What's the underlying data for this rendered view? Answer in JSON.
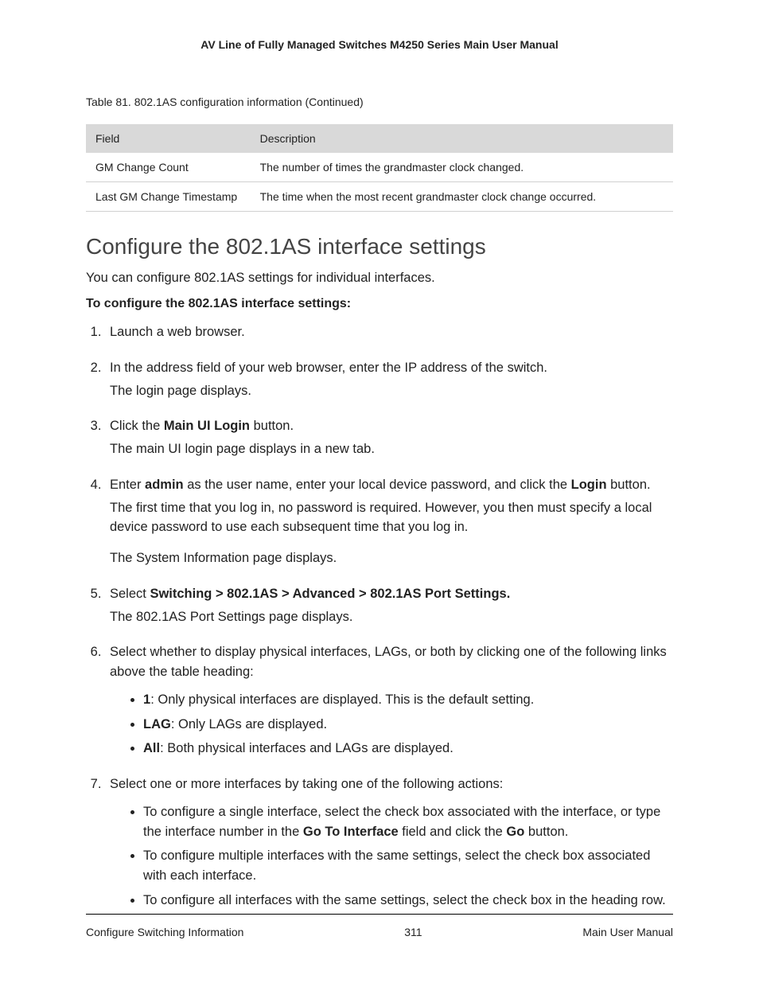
{
  "header_title": "AV Line of Fully Managed Switches M4250 Series Main User Manual",
  "table_caption": "Table 81. 802.1AS configuration information (Continued)",
  "table": {
    "headers": [
      "Field",
      "Description"
    ],
    "rows": [
      {
        "field": "GM Change Count",
        "desc": "The number of times the grandmaster clock changed."
      },
      {
        "field": "Last GM Change Timestamp",
        "desc": "The time when the most recent grandmaster clock change occurred."
      }
    ]
  },
  "section_heading": "Configure the 802.1AS interface settings",
  "intro": "You can configure 802.1AS settings for individual interfaces.",
  "subheading": "To configure the 802.1AS interface settings:",
  "steps": {
    "s1": "Launch a web browser.",
    "s2_a": "In the address field of your web browser, enter the IP address of the switch.",
    "s2_b": "The login page displays.",
    "s3_a_pre": "Click the ",
    "s3_a_bold": "Main UI Login",
    "s3_a_post": " button.",
    "s3_b": "The main UI login page displays in a new tab.",
    "s4_a_pre": "Enter ",
    "s4_a_bold1": "admin",
    "s4_a_mid": " as the user name, enter your local device password, and click the ",
    "s4_a_bold2": "Login",
    "s4_a_post": " button.",
    "s4_b": "The first time that you log in, no password is required. However, you then must specify a local device password to use each subsequent time that you log in.",
    "s4_c": "The System Information page displays.",
    "s5_a_pre": "Select ",
    "s5_a_bold": "Switching > 802.1AS > Advanced > 802.1AS Port Settings.",
    "s5_b": "The 802.1AS Port Settings page displays.",
    "s6_a": "Select whether to display physical interfaces, LAGs, or both by clicking one of the following links above the table heading:",
    "s6_b1_bold": "1",
    "s6_b1_text": ": Only physical interfaces are displayed. This is the default setting.",
    "s6_b2_bold": "LAG",
    "s6_b2_text": ": Only LAGs are displayed.",
    "s6_b3_bold": "All",
    "s6_b3_text": ": Both physical interfaces and LAGs are displayed.",
    "s7_a": "Select one or more interfaces by taking one of the following actions:",
    "s7_b1_pre": "To configure a single interface, select the check box associated with the interface, or type the interface number in the ",
    "s7_b1_bold1": "Go To Interface",
    "s7_b1_mid": " field and click the ",
    "s7_b1_bold2": "Go",
    "s7_b1_post": " button.",
    "s7_b2": "To configure multiple interfaces with the same settings, select the check box associated with each interface.",
    "s7_b3": "To configure all interfaces with the same settings, select the check box in the heading row."
  },
  "footer": {
    "left": "Configure Switching Information",
    "center": "311",
    "right": "Main User Manual"
  }
}
